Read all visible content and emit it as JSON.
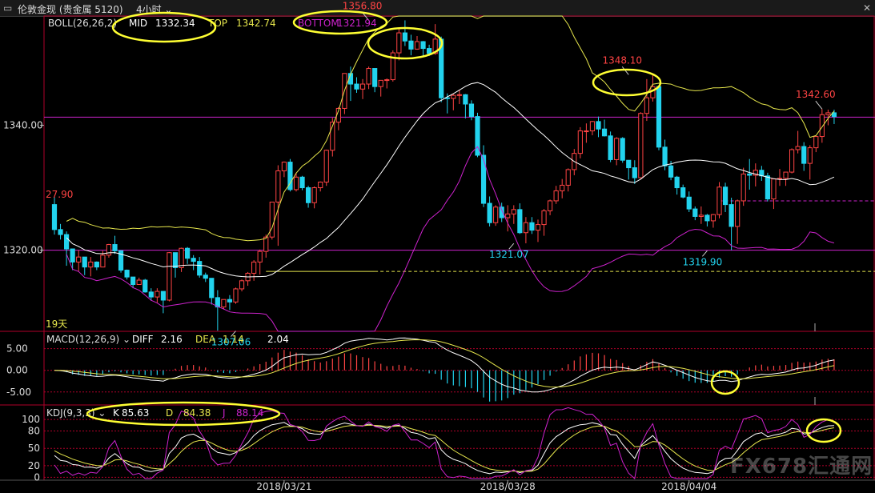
{
  "window": {
    "title": "伦敦金现 (贵金属 5120)",
    "period": "4小时",
    "close_icon": "close-icon"
  },
  "colors": {
    "up": "#ff4444",
    "down": "#22d3ee",
    "mid": "#ffffff",
    "top": "#e6e64c",
    "bottom": "#cc22cc",
    "grid": "#b0002a",
    "highlight_circle": "#ffff33",
    "hline": "#cc22cc",
    "hline_yellow": "#e6e64c"
  },
  "chart_data": {
    "type": "candlestick",
    "main": {
      "indicator_label": "BOLL(26,26,2)",
      "mid_label": "MID",
      "mid_value": "1332.34",
      "top_label": "TOP",
      "top_value": "1342.74",
      "bottom_label": "BOTTOM",
      "bottom_value": "1321.94",
      "y_ticks": [
        "1340.00",
        "1320.00"
      ],
      "y_tick_values": [
        1340,
        1320
      ],
      "y_range": [
        1307.0,
        1357.5
      ],
      "annotations": [
        {
          "text": "1356.80",
          "index": 52,
          "price": 1356.8,
          "kind": "high"
        },
        {
          "text": "1348.10",
          "index": 95,
          "price": 1348.1,
          "kind": "high"
        },
        {
          "text": "1342.60",
          "index": 127,
          "price": 1342.6,
          "kind": "high"
        },
        {
          "text": "1321.07",
          "index": 76,
          "price": 1321.07,
          "kind": "low"
        },
        {
          "text": "1319.90",
          "index": 108,
          "price": 1319.9,
          "kind": "low"
        },
        {
          "text": "1307.06",
          "index": 30,
          "price": 1307.06,
          "kind": "low"
        }
      ],
      "side_label_left": "27.90",
      "days_label": "19天",
      "hlines": [
        {
          "price": 1341.3,
          "style": "solid",
          "color": "hline",
          "from": 0
        },
        {
          "price": 1320.0,
          "style": "solid",
          "color": "hline",
          "from": 0
        },
        {
          "price": 1327.9,
          "style": "dashed",
          "color": "hline",
          "from": 110
        },
        {
          "price": 1316.6,
          "style": "solid",
          "color": "hline_yellow",
          "from": 35,
          "to": 53
        },
        {
          "price": 1316.6,
          "style": "dashed",
          "color": "hline_yellow",
          "from": 53
        }
      ],
      "ohlc": [
        [
          1327.3,
          1328.5,
          1322.5,
          1323.3
        ],
        [
          1323.3,
          1324.2,
          1321.7,
          1322.5
        ],
        [
          1322.5,
          1323.0,
          1317.5,
          1320.2
        ],
        [
          1320.2,
          1320.2,
          1316.8,
          1318.1
        ],
        [
          1318.1,
          1320.0,
          1316.6,
          1318.9
        ],
        [
          1318.9,
          1318.9,
          1316.0,
          1317.3
        ],
        [
          1317.3,
          1318.9,
          1315.8,
          1318.1
        ],
        [
          1318.1,
          1318.2,
          1316.8,
          1317.3
        ],
        [
          1317.3,
          1319.9,
          1317.3,
          1319.2
        ],
        [
          1319.2,
          1321.0,
          1318.8,
          1320.9
        ],
        [
          1320.9,
          1322.3,
          1319.4,
          1319.9
        ],
        [
          1319.9,
          1320.0,
          1316.4,
          1316.8
        ],
        [
          1316.8,
          1316.9,
          1315.3,
          1315.7
        ],
        [
          1315.7,
          1315.7,
          1313.9,
          1314.5
        ],
        [
          1314.5,
          1315.6,
          1314.5,
          1315.2
        ],
        [
          1315.2,
          1315.4,
          1313.2,
          1313.3
        ],
        [
          1313.3,
          1313.9,
          1311.9,
          1312.5
        ],
        [
          1312.5,
          1313.9,
          1311.6,
          1313.4
        ],
        [
          1313.4,
          1313.4,
          1309.9,
          1312.0
        ],
        [
          1312.0,
          1319.7,
          1311.8,
          1319.6
        ],
        [
          1319.6,
          1319.6,
          1315.6,
          1317.2
        ],
        [
          1317.2,
          1320.4,
          1316.5,
          1320.3
        ],
        [
          1320.3,
          1320.5,
          1317.8,
          1318.7
        ],
        [
          1318.7,
          1319.2,
          1316.8,
          1318.2
        ],
        [
          1318.2,
          1318.9,
          1315.6,
          1316.0
        ],
        [
          1316.0,
          1316.4,
          1314.9,
          1315.5
        ],
        [
          1315.5,
          1315.5,
          1311.3,
          1312.4
        ],
        [
          1312.4,
          1313.6,
          1307.1,
          1310.9
        ],
        [
          1310.9,
          1312.1,
          1310.5,
          1312.1
        ],
        [
          1312.1,
          1312.8,
          1310.4,
          1311.7
        ],
        [
          1311.7,
          1314.0,
          1311.4,
          1313.8
        ],
        [
          1313.8,
          1315.3,
          1313.4,
          1315.1
        ],
        [
          1315.1,
          1316.5,
          1314.3,
          1316.3
        ],
        [
          1316.3,
          1318.4,
          1315.1,
          1318.1
        ],
        [
          1318.1,
          1320.1,
          1316.1,
          1319.8
        ],
        [
          1319.8,
          1322.5,
          1318.8,
          1322.1
        ],
        [
          1322.1,
          1327.7,
          1321.7,
          1327.7
        ],
        [
          1327.7,
          1333.6,
          1320.7,
          1332.7
        ],
        [
          1332.7,
          1334.2,
          1331.7,
          1334.1
        ],
        [
          1334.1,
          1334.6,
          1329.4,
          1329.7
        ],
        [
          1329.7,
          1332.4,
          1329.4,
          1331.7
        ],
        [
          1331.7,
          1331.9,
          1329.6,
          1330.0
        ],
        [
          1330.0,
          1330.3,
          1326.8,
          1327.6
        ],
        [
          1327.6,
          1330.2,
          1326.7,
          1330.0
        ],
        [
          1330.0,
          1331.0,
          1329.4,
          1330.9
        ],
        [
          1330.9,
          1336.1,
          1330.3,
          1336.0
        ],
        [
          1336.0,
          1341.2,
          1335.0,
          1340.5
        ],
        [
          1340.5,
          1342.9,
          1339.2,
          1342.7
        ],
        [
          1342.7,
          1348.3,
          1341.8,
          1348.3
        ],
        [
          1348.3,
          1349.4,
          1343.9,
          1346.6
        ],
        [
          1346.6,
          1347.7,
          1345.2,
          1345.8
        ],
        [
          1345.8,
          1347.4,
          1344.2,
          1346.6
        ],
        [
          1346.6,
          1349.4,
          1345.8,
          1349.1
        ],
        [
          1349.1,
          1349.1,
          1345.3,
          1346.2
        ],
        [
          1346.2,
          1347.2,
          1344.6,
          1347.2
        ],
        [
          1347.2,
          1347.5,
          1345.9,
          1347.3
        ],
        [
          1347.3,
          1352.0,
          1347.0,
          1351.6
        ],
        [
          1351.6,
          1355.7,
          1350.4,
          1354.8
        ],
        [
          1354.8,
          1356.8,
          1352.7,
          1353.5
        ],
        [
          1353.5,
          1354.5,
          1351.2,
          1352.2
        ],
        [
          1352.2,
          1354.3,
          1352.1,
          1353.4
        ],
        [
          1353.4,
          1353.5,
          1351.0,
          1352.3
        ],
        [
          1352.3,
          1352.9,
          1351.1,
          1351.5
        ],
        [
          1351.5,
          1356.2,
          1351.3,
          1353.8
        ],
        [
          1353.8,
          1354.2,
          1343.7,
          1344.4
        ],
        [
          1344.4,
          1345.1,
          1341.9,
          1344.3
        ],
        [
          1344.3,
          1345.0,
          1342.4,
          1344.8
        ],
        [
          1344.8,
          1345.7,
          1343.4,
          1344.9
        ],
        [
          1344.9,
          1345.0,
          1341.1,
          1343.4
        ],
        [
          1343.4,
          1344.0,
          1340.8,
          1341.4
        ],
        [
          1341.4,
          1342.0,
          1334.9,
          1335.2
        ],
        [
          1335.2,
          1336.8,
          1326.9,
          1327.5
        ],
        [
          1327.5,
          1328.6,
          1323.8,
          1324.4
        ],
        [
          1324.4,
          1327.2,
          1323.9,
          1326.9
        ],
        [
          1326.9,
          1327.6,
          1324.5,
          1325.2
        ],
        [
          1325.2,
          1327.2,
          1323.0,
          1325.8
        ],
        [
          1325.8,
          1327.2,
          1324.2,
          1326.5
        ],
        [
          1326.5,
          1327.5,
          1322.6,
          1322.8
        ],
        [
          1322.8,
          1325.3,
          1321.1,
          1324.4
        ],
        [
          1324.4,
          1325.3,
          1322.6,
          1323.2
        ],
        [
          1323.2,
          1324.9,
          1321.3,
          1324.1
        ],
        [
          1324.1,
          1326.6,
          1322.3,
          1326.3
        ],
        [
          1326.3,
          1328.1,
          1325.6,
          1327.9
        ],
        [
          1327.9,
          1330.3,
          1327.4,
          1329.5
        ],
        [
          1329.5,
          1331.4,
          1328.3,
          1330.4
        ],
        [
          1330.4,
          1333.1,
          1329.4,
          1332.9
        ],
        [
          1332.9,
          1336.2,
          1332.0,
          1335.5
        ],
        [
          1335.5,
          1339.7,
          1334.7,
          1339.1
        ],
        [
          1339.1,
          1340.3,
          1337.2,
          1339.1
        ],
        [
          1339.1,
          1340.7,
          1338.4,
          1340.6
        ],
        [
          1340.6,
          1341.4,
          1338.1,
          1339.4
        ],
        [
          1339.4,
          1340.9,
          1338.2,
          1338.3
        ],
        [
          1338.3,
          1339.0,
          1334.1,
          1334.5
        ],
        [
          1334.5,
          1338.1,
          1333.6,
          1337.9
        ],
        [
          1337.9,
          1338.1,
          1334.0,
          1334.4
        ],
        [
          1334.4,
          1334.4,
          1331.3,
          1333.2
        ],
        [
          1333.2,
          1334.4,
          1330.6,
          1331.6
        ],
        [
          1331.6,
          1342.1,
          1331.5,
          1341.9
        ],
        [
          1341.9,
          1347.4,
          1340.7,
          1344.4
        ],
        [
          1344.4,
          1348.1,
          1343.8,
          1346.2
        ],
        [
          1346.2,
          1346.3,
          1336.0,
          1336.5
        ],
        [
          1336.5,
          1337.7,
          1332.8,
          1333.5
        ],
        [
          1333.5,
          1334.3,
          1331.2,
          1331.7
        ],
        [
          1331.7,
          1331.9,
          1328.9,
          1330.0
        ],
        [
          1330.0,
          1330.5,
          1328.3,
          1328.5
        ],
        [
          1328.5,
          1329.4,
          1326.1,
          1326.6
        ],
        [
          1326.6,
          1327.0,
          1324.8,
          1325.4
        ],
        [
          1325.4,
          1327.0,
          1324.2,
          1325.6
        ],
        [
          1325.6,
          1325.8,
          1323.8,
          1324.7
        ],
        [
          1324.7,
          1325.8,
          1323.6,
          1325.7
        ],
        [
          1325.7,
          1330.9,
          1325.1,
          1330.1
        ],
        [
          1330.1,
          1330.8,
          1326.1,
          1327.3
        ],
        [
          1327.3,
          1328.4,
          1320.0,
          1323.8
        ],
        [
          1323.8,
          1328.1,
          1321.0,
          1327.9
        ],
        [
          1327.9,
          1333.2,
          1327.1,
          1332.2
        ],
        [
          1332.2,
          1334.6,
          1329.7,
          1332.0
        ],
        [
          1332.0,
          1333.9,
          1330.2,
          1332.8
        ],
        [
          1332.8,
          1333.5,
          1331.1,
          1331.9
        ],
        [
          1331.9,
          1332.4,
          1327.8,
          1328.2
        ],
        [
          1328.2,
          1331.5,
          1326.6,
          1331.4
        ],
        [
          1331.4,
          1333.0,
          1330.3,
          1331.5
        ],
        [
          1331.5,
          1332.5,
          1330.3,
          1332.5
        ],
        [
          1332.5,
          1336.3,
          1332.3,
          1336.1
        ],
        [
          1336.1,
          1339.1,
          1335.5,
          1336.6
        ],
        [
          1336.6,
          1337.3,
          1332.7,
          1333.9
        ],
        [
          1333.9,
          1336.8,
          1331.3,
          1336.4
        ],
        [
          1336.4,
          1338.3,
          1335.7,
          1338.2
        ],
        [
          1338.2,
          1342.6,
          1337.2,
          1341.7
        ],
        [
          1341.7,
          1342.5,
          1340.0,
          1342.0
        ],
        [
          1342.0,
          1342.5,
          1340.2,
          1341.4
        ]
      ],
      "x_ticks": [
        {
          "label": "2018/03/21",
          "index": 38
        },
        {
          "label": "2018/03/28",
          "index": 75
        },
        {
          "label": "2018/04/04",
          "index": 105
        }
      ]
    },
    "macd": {
      "label": "MACD(12,26,9)",
      "diff_label": "DIFF",
      "diff_value": "2.16",
      "dea_label": "DEA",
      "dea_value": "1.14",
      "macd_value": "2.04",
      "y_ticks": [
        "5.00",
        "0.00",
        "-5.00"
      ],
      "y_tick_values": [
        5,
        0,
        -5
      ],
      "y_range": [
        -8,
        9
      ]
    },
    "kdj": {
      "label": "KDJ(9,3,3)",
      "k_label": "K",
      "k_value": "85.63",
      "d_label": "D",
      "d_value": "84.38",
      "j_label": "J",
      "j_value": "88.14",
      "y_ticks": [
        "100",
        "80",
        "50",
        "20",
        "0"
      ],
      "y_tick_values": [
        100,
        80,
        50,
        20,
        0
      ],
      "y_range": [
        -5,
        125
      ]
    },
    "watermark": "FX678汇通网"
  }
}
